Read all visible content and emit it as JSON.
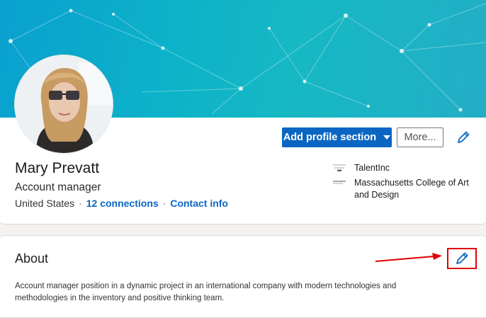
{
  "profile": {
    "name": "Mary Prevatt",
    "headline": "Account manager",
    "location": "United States",
    "connections": "12 connections",
    "contact": "Contact info"
  },
  "actions": {
    "add_section": "Add profile section",
    "more": "More..."
  },
  "orgs": [
    {
      "name": "TalentInc"
    },
    {
      "name": "Massachusetts College of Art and Design"
    }
  ],
  "about": {
    "title": "About",
    "text": "Account manager position in a dynamic project in an international company with modern technologies and methodologies in the inventory and positive thinking team."
  },
  "colors": {
    "primary": "#0a66c2",
    "banner": "#0cb2c9",
    "annotation": "#e00000"
  }
}
